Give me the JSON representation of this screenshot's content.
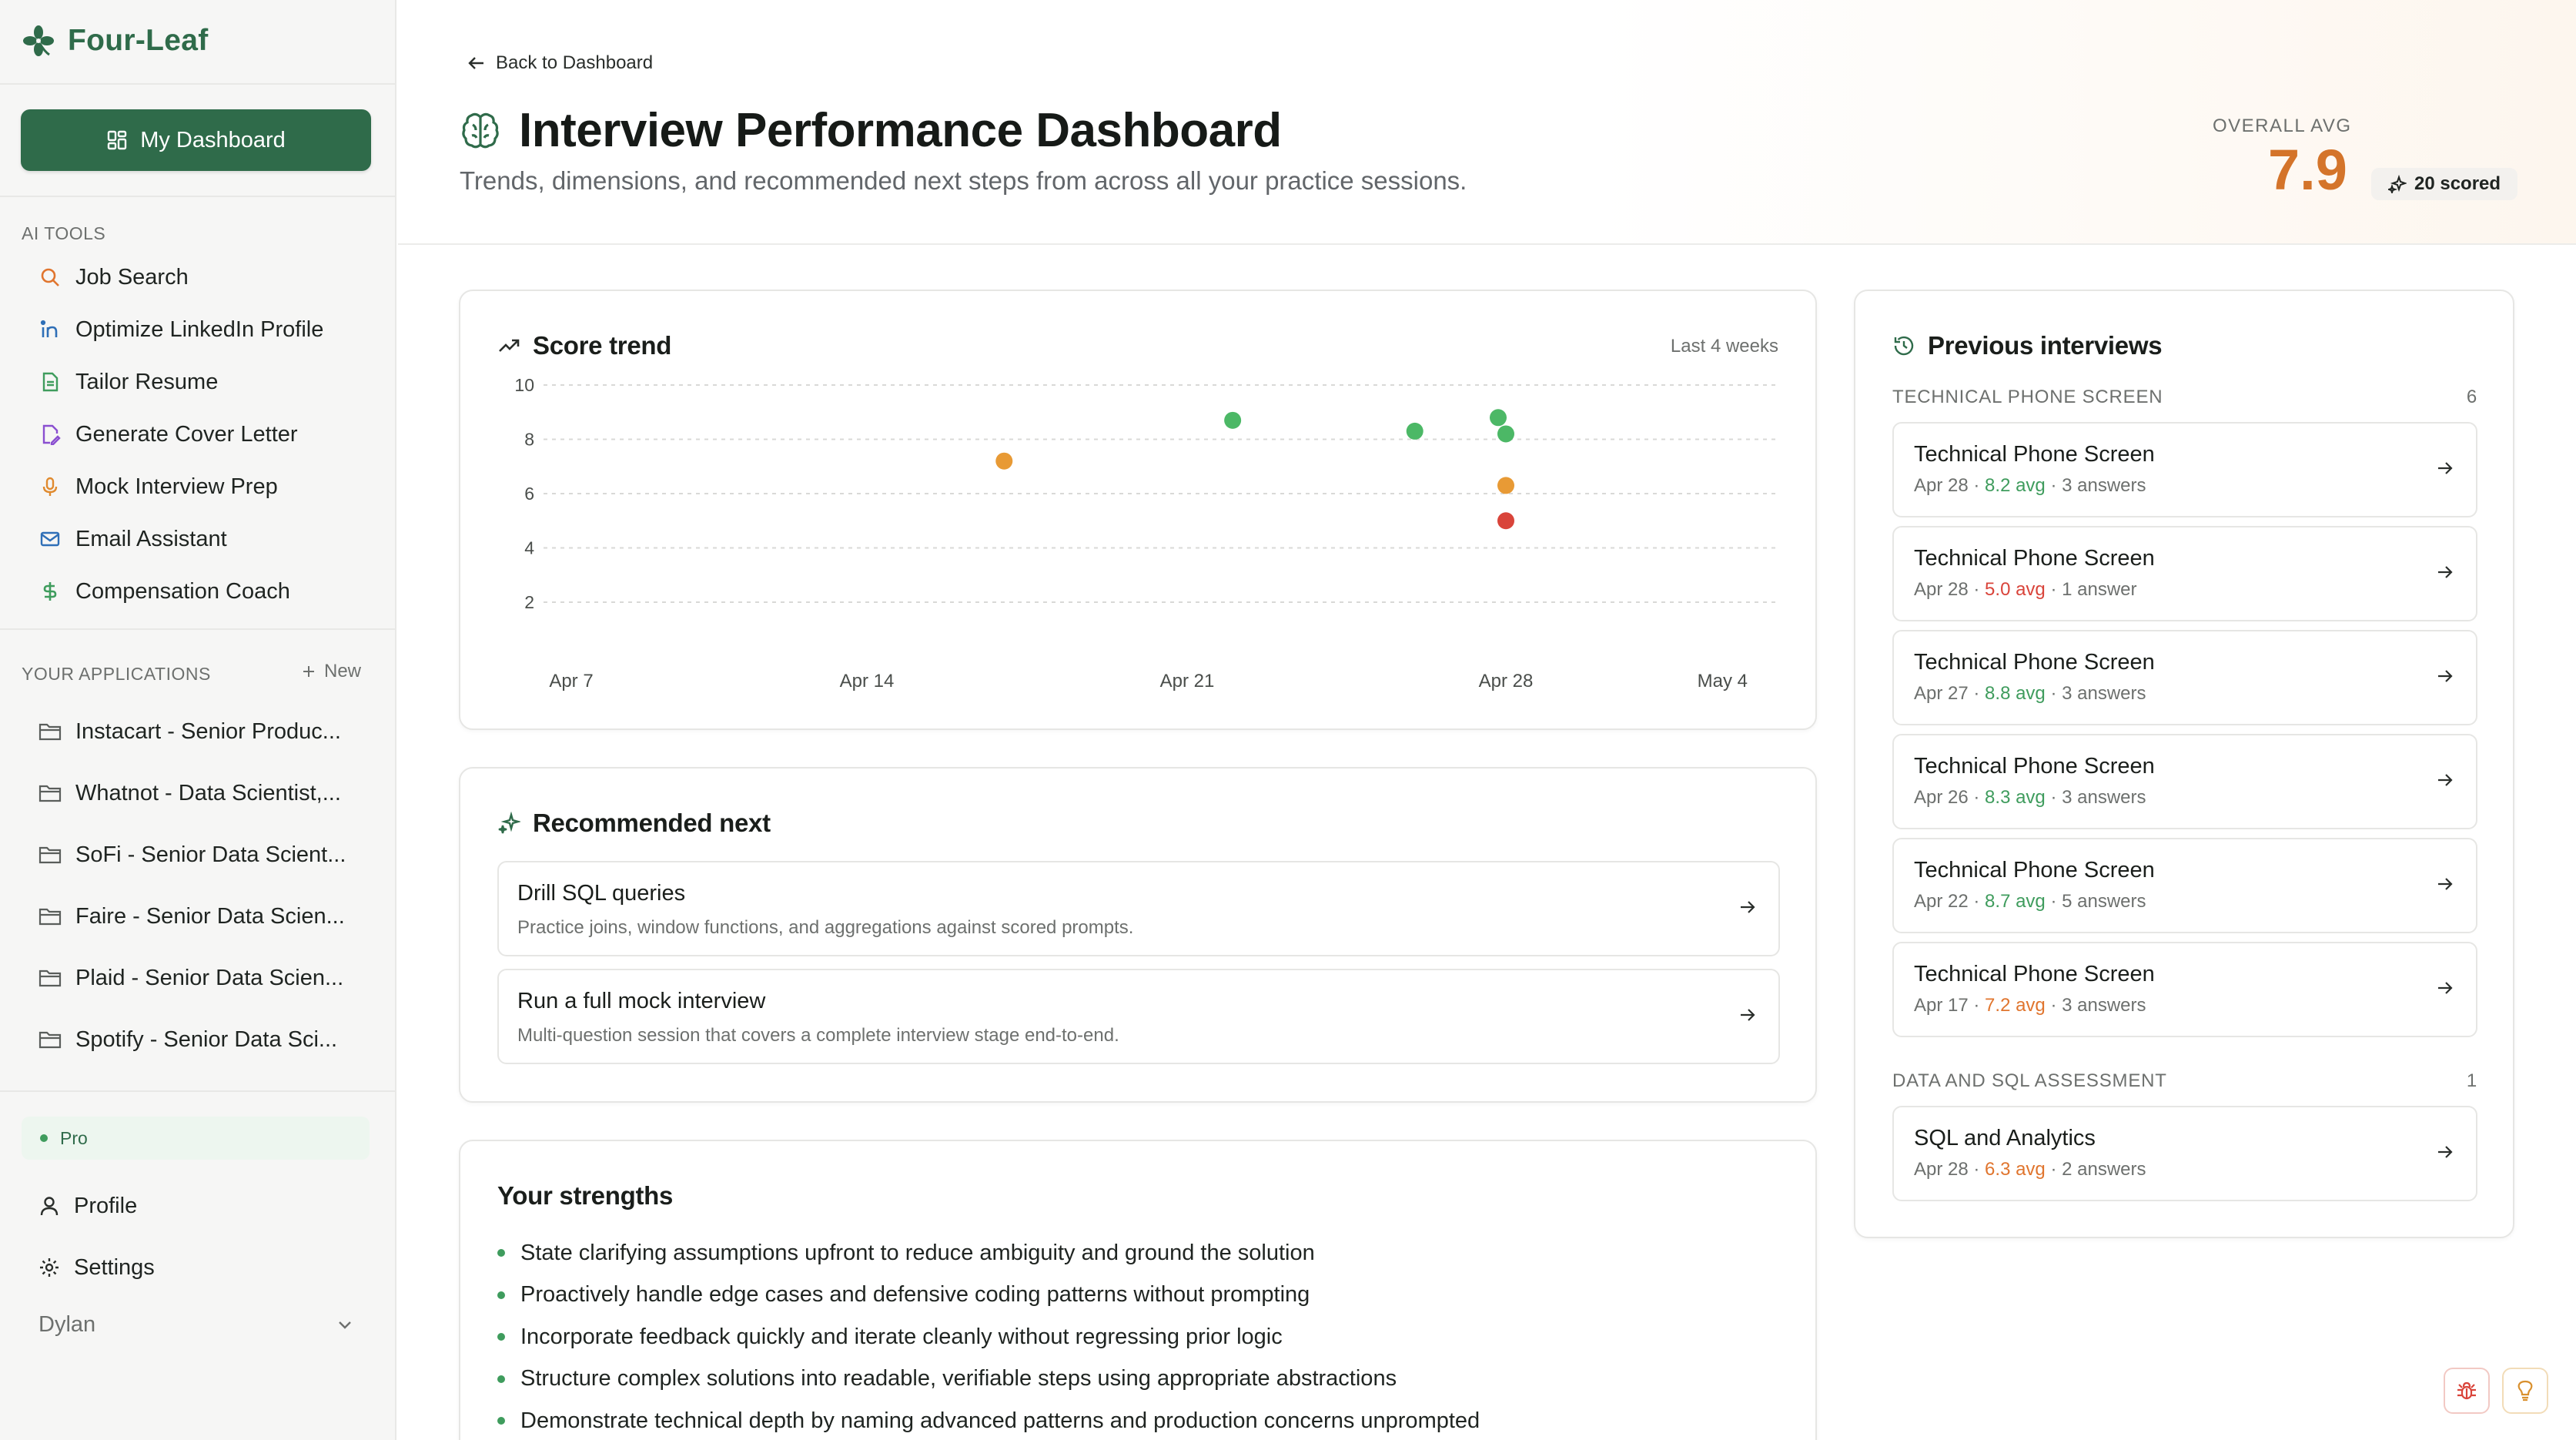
{
  "brand": {
    "name": "Four-Leaf"
  },
  "sidebar": {
    "dashboard_label": "My Dashboard",
    "ai_tools_label": "AI TOOLS",
    "tools": [
      {
        "label": "Job Search",
        "icon": "search-icon",
        "color": "#e0752e"
      },
      {
        "label": "Optimize LinkedIn Profile",
        "icon": "linkedin-icon",
        "color": "#2f6fb7"
      },
      {
        "label": "Tailor Resume",
        "icon": "document-icon",
        "color": "#3f9c5d"
      },
      {
        "label": "Generate Cover Letter",
        "icon": "file-pen-icon",
        "color": "#8a4fd0"
      },
      {
        "label": "Mock Interview Prep",
        "icon": "microphone-icon",
        "color": "#e08a2e"
      },
      {
        "label": "Email Assistant",
        "icon": "mail-icon",
        "color": "#2f6fb7"
      },
      {
        "label": "Compensation Coach",
        "icon": "dollar-icon",
        "color": "#3f9c5d"
      }
    ],
    "applications_label": "YOUR APPLICATIONS",
    "new_label": "New",
    "applications": [
      "Instacart - Senior Produc...",
      "Whatnot - Data Scientist,...",
      "SoFi - Senior Data Scient...",
      "Faire - Senior Data Scien...",
      "Plaid - Senior Data Scien...",
      "Spotify - Senior Data Sci..."
    ],
    "plan_badge": "Pro",
    "profile_label": "Profile",
    "settings_label": "Settings",
    "user_name": "Dylan"
  },
  "header": {
    "back_label": "Back to Dashboard",
    "title": "Interview Performance Dashboard",
    "subtitle": "Trends, dimensions, and recommended next steps from across all your practice sessions.",
    "overall_label": "OVERALL AVG",
    "overall_value": "7.9",
    "scored_label": "20 scored"
  },
  "trend": {
    "title": "Score trend",
    "range_label": "Last 4 weeks"
  },
  "chart_data": {
    "type": "scatter",
    "title": "Score trend",
    "ylim": [
      0,
      10
    ],
    "y_ticks": [
      "10",
      "8",
      "6",
      "4",
      "2"
    ],
    "y_tick_values": [
      10,
      8,
      6,
      4,
      2
    ],
    "x_ticks": [
      "Apr 7",
      "Apr 14",
      "Apr 21",
      "Apr 28",
      "May 4"
    ],
    "x_tick_values": [
      "2025-04-07",
      "2025-04-14",
      "2025-04-21",
      "2025-04-28",
      "2025-05-04"
    ],
    "grid": true,
    "points": [
      {
        "x": "2025-04-17",
        "y": 7.2,
        "color": "#e89a35"
      },
      {
        "x": "2025-04-22",
        "y": 8.7,
        "color": "#4cb866"
      },
      {
        "x": "2025-04-26",
        "y": 8.3,
        "color": "#4cb866"
      },
      {
        "x": "2025-04-28",
        "y": 8.8,
        "color": "#4cb866"
      },
      {
        "x": "2025-04-28",
        "y": 8.2,
        "color": "#4cb866"
      },
      {
        "x": "2025-04-28",
        "y": 6.3,
        "color": "#e89a35"
      },
      {
        "x": "2025-04-28",
        "y": 5.0,
        "color": "#d9443a"
      }
    ]
  },
  "recommended": {
    "title": "Recommended next",
    "items": [
      {
        "title": "Drill SQL queries",
        "desc": "Practice joins, window functions, and aggregations against scored prompts."
      },
      {
        "title": "Run a full mock interview",
        "desc": "Multi-question session that covers a complete interview stage end-to-end."
      }
    ]
  },
  "strengths": {
    "title": "Your strengths",
    "items": [
      "State clarifying assumptions upfront to reduce ambiguity and ground the solution",
      "Proactively handle edge cases and defensive coding patterns without prompting",
      "Incorporate feedback quickly and iterate cleanly without regressing prior logic",
      "Structure complex solutions into readable, verifiable steps using appropriate abstractions",
      "Demonstrate technical depth by naming advanced patterns and production concerns unprompted"
    ]
  },
  "previous": {
    "title": "Previous interviews",
    "groups": [
      {
        "name": "TECHNICAL PHONE SCREEN",
        "count": "6",
        "items": [
          {
            "title": "Technical Phone Screen",
            "date": "Apr 28",
            "avg": "8.2 avg",
            "avg_color": "#3f9c5d",
            "answers": "3 answers"
          },
          {
            "title": "Technical Phone Screen",
            "date": "Apr 28",
            "avg": "5.0 avg",
            "avg_color": "#d9443a",
            "answers": "1 answer"
          },
          {
            "title": "Technical Phone Screen",
            "date": "Apr 27",
            "avg": "8.8 avg",
            "avg_color": "#3f9c5d",
            "answers": "3 answers"
          },
          {
            "title": "Technical Phone Screen",
            "date": "Apr 26",
            "avg": "8.3 avg",
            "avg_color": "#3f9c5d",
            "answers": "3 answers"
          },
          {
            "title": "Technical Phone Screen",
            "date": "Apr 22",
            "avg": "8.7 avg",
            "avg_color": "#3f9c5d",
            "answers": "5 answers"
          },
          {
            "title": "Technical Phone Screen",
            "date": "Apr 17",
            "avg": "7.2 avg",
            "avg_color": "#e0752e",
            "answers": "3 answers"
          }
        ]
      },
      {
        "name": "DATA AND SQL ASSESSMENT",
        "count": "1",
        "items": [
          {
            "title": "SQL and Analytics",
            "date": "Apr 28",
            "avg": "6.3 avg",
            "avg_color": "#e0752e",
            "answers": "2 answers"
          }
        ]
      }
    ]
  },
  "meta_separator": " · ",
  "colors": {
    "brand": "#2f6b4a",
    "accent": "#d4742a"
  }
}
